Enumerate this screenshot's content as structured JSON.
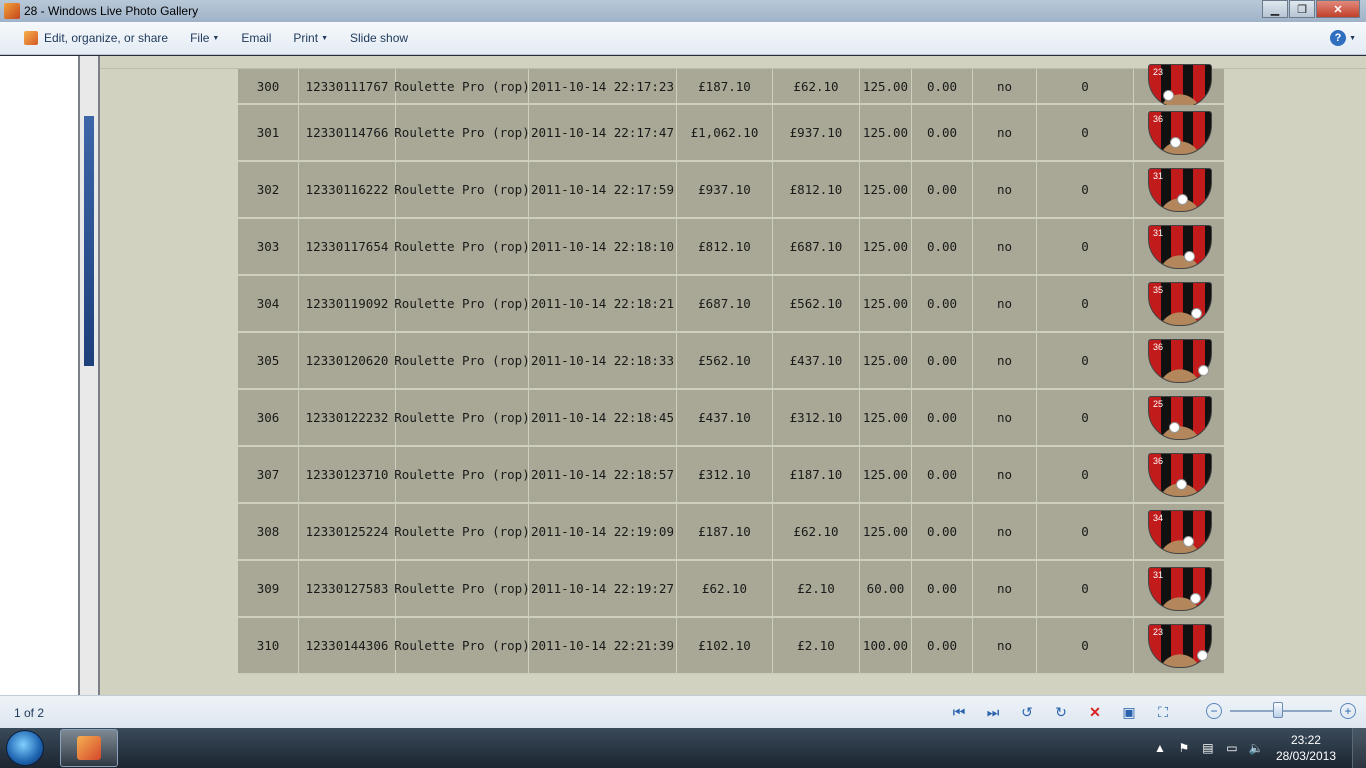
{
  "window": {
    "title": "28 - Windows Live Photo Gallery"
  },
  "toolbar": {
    "edit_label": "Edit, organize, or share",
    "file_label": "File",
    "email_label": "Email",
    "print_label": "Print",
    "slideshow_label": "Slide show"
  },
  "rows": [
    {
      "n": "300",
      "id": "12330111767",
      "game": "Roulette Pro (rop)",
      "time": "2011-10-14 22:17:23",
      "start": "£187.10",
      "end": "£62.10",
      "bet": "125.00",
      "win": "0.00",
      "flag": "no",
      "count": "0",
      "wheel_num": "23"
    },
    {
      "n": "301",
      "id": "12330114766",
      "game": "Roulette Pro (rop)",
      "time": "2011-10-14 22:17:47",
      "start": "£1,062.10",
      "end": "£937.10",
      "bet": "125.00",
      "win": "0.00",
      "flag": "no",
      "count": "0",
      "wheel_num": "36"
    },
    {
      "n": "302",
      "id": "12330116222",
      "game": "Roulette Pro (rop)",
      "time": "2011-10-14 22:17:59",
      "start": "£937.10",
      "end": "£812.10",
      "bet": "125.00",
      "win": "0.00",
      "flag": "no",
      "count": "0",
      "wheel_num": "31"
    },
    {
      "n": "303",
      "id": "12330117654",
      "game": "Roulette Pro (rop)",
      "time": "2011-10-14 22:18:10",
      "start": "£812.10",
      "end": "£687.10",
      "bet": "125.00",
      "win": "0.00",
      "flag": "no",
      "count": "0",
      "wheel_num": "31"
    },
    {
      "n": "304",
      "id": "12330119092",
      "game": "Roulette Pro (rop)",
      "time": "2011-10-14 22:18:21",
      "start": "£687.10",
      "end": "£562.10",
      "bet": "125.00",
      "win": "0.00",
      "flag": "no",
      "count": "0",
      "wheel_num": "35"
    },
    {
      "n": "305",
      "id": "12330120620",
      "game": "Roulette Pro (rop)",
      "time": "2011-10-14 22:18:33",
      "start": "£562.10",
      "end": "£437.10",
      "bet": "125.00",
      "win": "0.00",
      "flag": "no",
      "count": "0",
      "wheel_num": "36"
    },
    {
      "n": "306",
      "id": "12330122232",
      "game": "Roulette Pro (rop)",
      "time": "2011-10-14 22:18:45",
      "start": "£437.10",
      "end": "£312.10",
      "bet": "125.00",
      "win": "0.00",
      "flag": "no",
      "count": "0",
      "wheel_num": "25"
    },
    {
      "n": "307",
      "id": "12330123710",
      "game": "Roulette Pro (rop)",
      "time": "2011-10-14 22:18:57",
      "start": "£312.10",
      "end": "£187.10",
      "bet": "125.00",
      "win": "0.00",
      "flag": "no",
      "count": "0",
      "wheel_num": "36"
    },
    {
      "n": "308",
      "id": "12330125224",
      "game": "Roulette Pro (rop)",
      "time": "2011-10-14 22:19:09",
      "start": "£187.10",
      "end": "£62.10",
      "bet": "125.00",
      "win": "0.00",
      "flag": "no",
      "count": "0",
      "wheel_num": "34"
    },
    {
      "n": "309",
      "id": "12330127583",
      "game": "Roulette Pro (rop)",
      "time": "2011-10-14 22:19:27",
      "start": "£62.10",
      "end": "£2.10",
      "bet": "60.00",
      "win": "0.00",
      "flag": "no",
      "count": "0",
      "wheel_num": "31"
    },
    {
      "n": "310",
      "id": "12330144306",
      "game": "Roulette Pro (rop)",
      "time": "2011-10-14 22:21:39",
      "start": "£102.10",
      "end": "£2.10",
      "bet": "100.00",
      "win": "0.00",
      "flag": "no",
      "count": "0",
      "wheel_num": "23"
    }
  ],
  "status": {
    "counter": "1 of 2",
    "zoom_level": 0.42
  },
  "taskbar": {
    "time": "23:22",
    "date": "28/03/2013"
  }
}
